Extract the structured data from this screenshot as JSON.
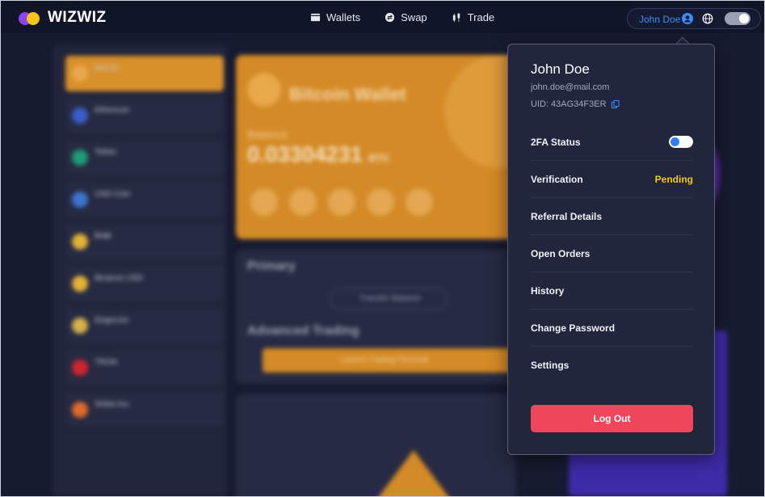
{
  "brand": {
    "name": "WIZWIZ"
  },
  "nav": {
    "links": [
      {
        "label": "Wallets",
        "icon": "wallet-icon"
      },
      {
        "label": "Swap",
        "icon": "swap-icon"
      },
      {
        "label": "Trade",
        "icon": "candlestick-icon"
      }
    ]
  },
  "header": {
    "user_name": "John Doe",
    "icons": [
      "user-circle-icon",
      "globe-icon",
      "theme-toggle"
    ]
  },
  "background": {
    "coins": [
      {
        "name": "Bitcoin",
        "active": true,
        "color": "#e8a94b"
      },
      {
        "name": "Ethereum",
        "color": "#3d5ec9"
      },
      {
        "name": "Tether",
        "color": "#1e9c78"
      },
      {
        "name": "USD Coin",
        "color": "#3b75d1"
      },
      {
        "name": "BNB",
        "color": "#e3b237"
      },
      {
        "name": "Binance USD",
        "color": "#e3b237"
      },
      {
        "name": "Dogecoin",
        "color": "#d6b24a"
      },
      {
        "name": "TRON",
        "color": "#d3242f"
      },
      {
        "name": "Shiba Inu",
        "color": "#e06a2c"
      }
    ],
    "wallet_title": "Bitcoin Wallet",
    "balance_label": "Balance",
    "balance_value": "0.03304231",
    "balance_unit": "BTC",
    "primary_label": "Primary",
    "advanced_label": "Advanced Trading",
    "transfer_label": "Transfer Balance",
    "launch_label": "Launch Trading Terminal"
  },
  "dropdown": {
    "name": "John Doe",
    "email": "john.doe@mail.com",
    "uid": "UID: 43AG34F3ER",
    "items": [
      {
        "label": "2FA Status"
      },
      {
        "label": "Verification",
        "value": "Pending"
      },
      {
        "label": "Referral Details"
      },
      {
        "label": "Open Orders"
      },
      {
        "label": "History"
      },
      {
        "label": "Change Password"
      },
      {
        "label": "Settings"
      }
    ],
    "twofa_enabled": true,
    "logout_label": "Log Out"
  },
  "colors": {
    "accent_blue": "#3b8df7",
    "pending_yellow": "#f5c518",
    "logout_red": "#f0465c",
    "btc_orange": "#d48a26"
  }
}
